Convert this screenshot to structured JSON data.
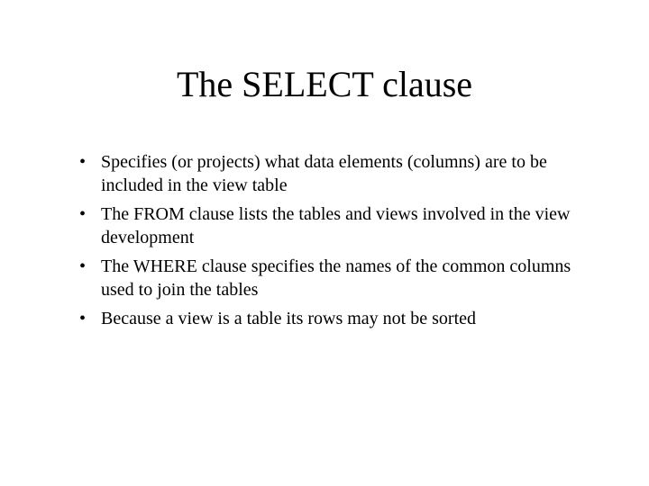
{
  "title": "The SELECT clause",
  "bullets": [
    "Specifies (or projects) what data elements (columns) are to be included in the view table",
    "The FROM clause lists the tables and views involved in the view development",
    "The WHERE clause specifies the names of the common columns used to join the tables",
    "Because a view is a table its rows may not be sorted"
  ]
}
